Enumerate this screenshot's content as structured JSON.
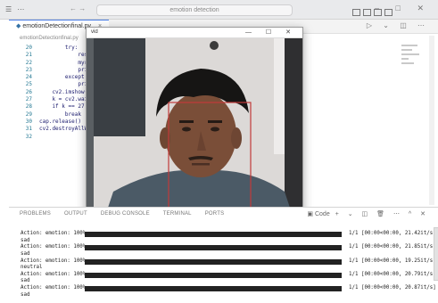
{
  "titlebar": {
    "search_text": "emotion detection",
    "window_controls": "– □ ✕"
  },
  "editor": {
    "tab_label": "emotionDetectionfinal.py",
    "breadcrumb": "emotionDetectionfinal.py",
    "code_lines": [
      {
        "num": "20",
        "text": "        try:"
      },
      {
        "num": "21",
        "text": "            resu"
      },
      {
        "num": "22",
        "text": "            myr"
      },
      {
        "num": "23",
        "text": "            pri"
      },
      {
        "num": "24",
        "text": "        except"
      },
      {
        "num": "25",
        "text": "            pri"
      },
      {
        "num": "26",
        "text": "    cv2.imshow("
      },
      {
        "num": "27",
        "text": "    k = cv2.wai"
      },
      {
        "num": "28",
        "text": "    if k == 27"
      },
      {
        "num": "29",
        "text": "        break"
      },
      {
        "num": "30",
        "text": "cap.release()"
      },
      {
        "num": "31",
        "text": "cv2.destroyAllW"
      },
      {
        "num": "32",
        "text": ""
      }
    ]
  },
  "webcam_window": {
    "title": "vid",
    "controls": "— ☐ ✕"
  },
  "panel": {
    "tabs": [
      "PROBLEMS",
      "OUTPUT",
      "DEBUG CONSOLE",
      "TERMINAL",
      "PORTS"
    ],
    "terminal_select": "Code"
  },
  "terminal_output": [
    {
      "action": "Action: emotion: 100%",
      "progress": "1/1 [00:00<00:00, 21.42it/s]",
      "emotion": "sad"
    },
    {
      "action": "Action: emotion: 100%",
      "progress": "1/1 [00:00<00:00, 21.85it/s]",
      "emotion": "sad"
    },
    {
      "action": "Action: emotion: 100%",
      "progress": "1/1 [00:00<00:00, 19.25it/s]",
      "emotion": "neutral"
    },
    {
      "action": "Action: emotion: 100%",
      "progress": "1/1 [00:00<00:00, 20.79it/s]",
      "emotion": "sad"
    },
    {
      "action": "Action: emotion: 100%",
      "progress": "1/1 [00:00<00:00, 20.87it/s]",
      "emotion": "sad"
    }
  ],
  "colors": {
    "accent": "#4a7ee6",
    "face_box": "#c23a3a",
    "progress_bar": "#222222"
  }
}
